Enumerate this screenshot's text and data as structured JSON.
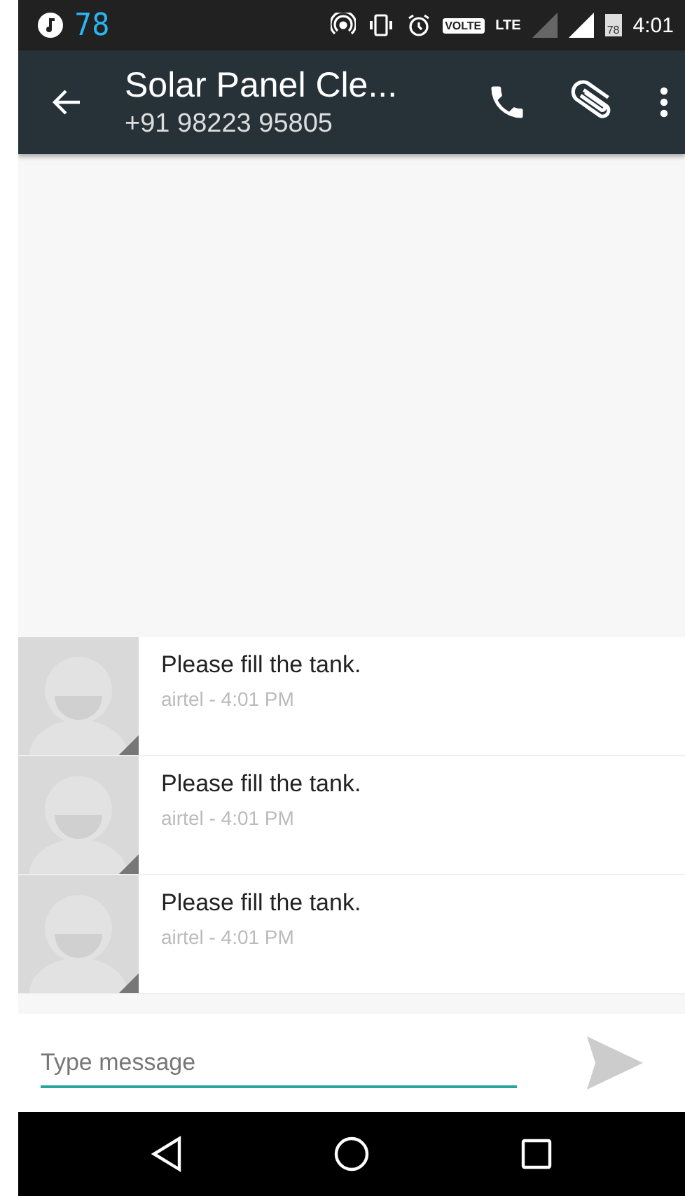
{
  "status_bar": {
    "notification_count": "78",
    "volte": "VOLTE",
    "network": "LTE",
    "battery": "78",
    "time": "4:01"
  },
  "header": {
    "title": "Solar Panel Cle...",
    "subtitle": "+91 98223 95805"
  },
  "messages": [
    {
      "text": "Please fill the tank.",
      "meta": "airtel - 4:01 PM"
    },
    {
      "text": "Please fill the tank.",
      "meta": "airtel - 4:01 PM"
    },
    {
      "text": "Please fill the tank.",
      "meta": "airtel - 4:01 PM"
    }
  ],
  "compose": {
    "placeholder": "Type message"
  }
}
